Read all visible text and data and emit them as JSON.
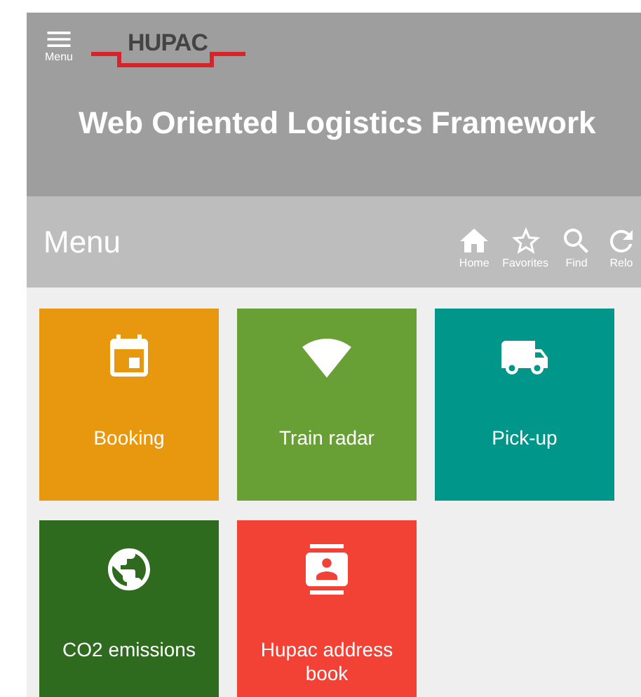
{
  "header": {
    "menu_label": "Menu",
    "logo": "HUPAC",
    "title": "Web Oriented Logistics Framework"
  },
  "menu_bar": {
    "title": "Menu",
    "actions": [
      {
        "kind": "home",
        "label": "Home"
      },
      {
        "kind": "favorites",
        "label": "Favorites"
      },
      {
        "kind": "find",
        "label": "Find"
      },
      {
        "kind": "reload",
        "label": "Relo"
      }
    ]
  },
  "tiles": [
    {
      "kind": "calendar",
      "label": "Booking",
      "color": "#e8980f"
    },
    {
      "kind": "radar",
      "label": "Train radar",
      "color": "#68a035"
    },
    {
      "kind": "truck",
      "label": "Pick-up",
      "color": "#00968a"
    },
    {
      "kind": "globe",
      "label": "CO2 emissions",
      "color": "#2e6b1f"
    },
    {
      "kind": "contacts",
      "label": "Hupac address book",
      "color": "#f24236"
    }
  ]
}
